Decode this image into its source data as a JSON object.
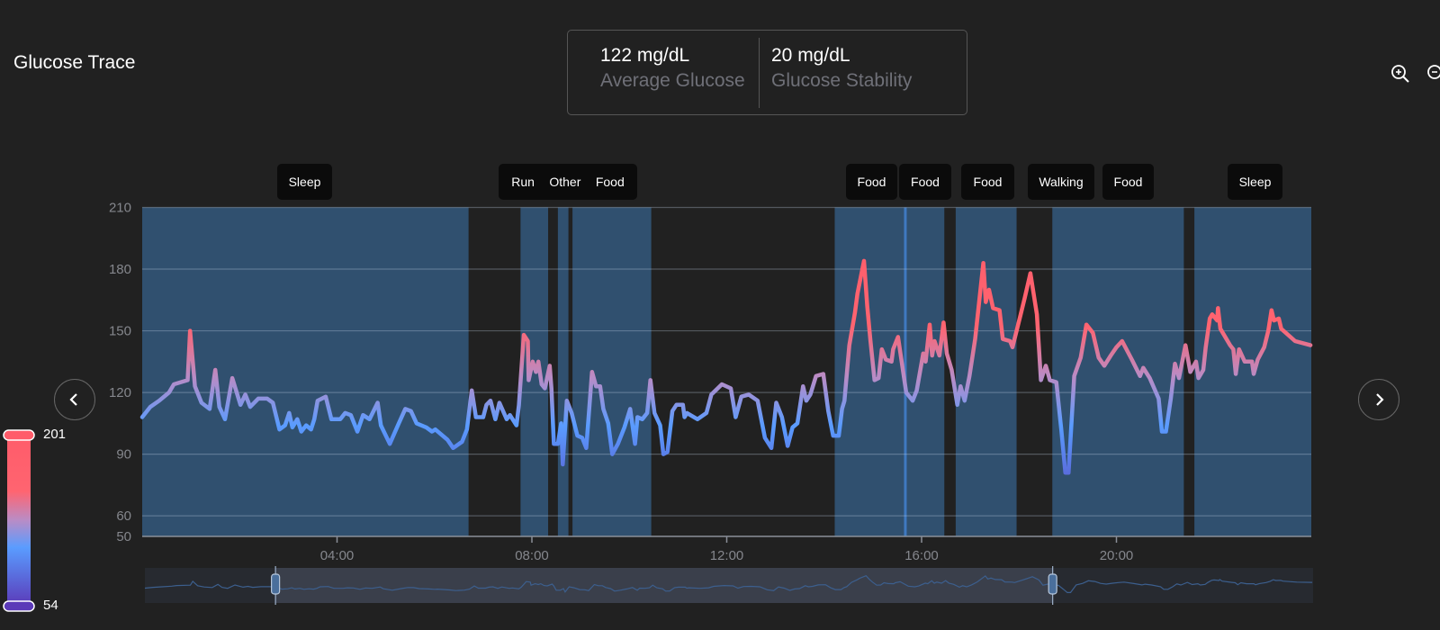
{
  "header": {
    "title": "Glucose Trace"
  },
  "stats": [
    {
      "value": "122 mg/dL",
      "label": "Average Glucose"
    },
    {
      "value": "20 mg/dL",
      "label": "Glucose Stability"
    }
  ],
  "toolbar": {
    "zoom_in_icon": "zoom-in-icon",
    "zoom_out_icon": "zoom-out-icon"
  },
  "navigation": {
    "prev_icon": "chevron-left-icon",
    "next_icon": "chevron-right-icon"
  },
  "legend": {
    "max": "201",
    "min": "54",
    "colors": [
      "#ff5c6a",
      "#ff6470",
      "#b98cc6",
      "#5a9cff",
      "#5b3ab8"
    ]
  },
  "events": [
    "Sleep",
    "Run",
    "Other",
    "Food",
    "Food",
    "Food",
    "Food",
    "Walking",
    "Food",
    "Sleep"
  ],
  "navigator": {
    "selection": [
      "02:41",
      "18:39"
    ]
  },
  "colors": {
    "background": "#212121",
    "band": "#30506f",
    "line_high": "#ff5c6a",
    "line_mid": "#b98cc6",
    "line_low": "#5a9cff"
  },
  "chart_data": {
    "type": "line",
    "title": "",
    "xlabel": "",
    "ylabel": "",
    "ylim": [
      50,
      210
    ],
    "xlim": [
      "00:00",
      "24:00"
    ],
    "yticks": [
      50,
      60,
      90,
      120,
      150,
      180,
      210
    ],
    "xticks": [
      "04:00",
      "08:00",
      "12:00",
      "16:00",
      "20:00"
    ],
    "grid": true,
    "color_scale": {
      "min": 54,
      "max": 201
    },
    "bands": [
      [
        "00:00",
        "06:42"
      ],
      [
        "07:46",
        "08:20"
      ],
      [
        "08:32",
        "08:45"
      ],
      [
        "08:50",
        "10:27"
      ],
      [
        "14:13",
        "16:28"
      ],
      [
        "16:42",
        "17:57"
      ],
      [
        "18:41",
        "21:23"
      ],
      [
        "21:36",
        "24:00"
      ]
    ],
    "marker_lines": [
      "15:40"
    ],
    "points": [
      [
        "00:00",
        108
      ],
      [
        "00:10",
        113
      ],
      [
        "00:21",
        116
      ],
      [
        "00:33",
        120
      ],
      [
        "00:39",
        124
      ],
      [
        "00:56",
        126
      ],
      [
        "00:59",
        150
      ],
      [
        "01:05",
        123
      ],
      [
        "01:13",
        115
      ],
      [
        "01:23",
        112
      ],
      [
        "01:30",
        131
      ],
      [
        "01:35",
        113
      ],
      [
        "01:42",
        107
      ],
      [
        "01:51",
        127
      ],
      [
        "02:01",
        114
      ],
      [
        "02:07",
        119
      ],
      [
        "02:13",
        113
      ],
      [
        "02:23",
        117
      ],
      [
        "02:34",
        117
      ],
      [
        "02:41",
        115
      ],
      [
        "02:49",
        102
      ],
      [
        "02:56",
        104
      ],
      [
        "03:01",
        110
      ],
      [
        "03:05",
        103
      ],
      [
        "03:11",
        107
      ],
      [
        "03:16",
        101
      ],
      [
        "03:22",
        104
      ],
      [
        "03:28",
        102
      ],
      [
        "03:32",
        107
      ],
      [
        "03:36",
        116
      ],
      [
        "03:46",
        118
      ],
      [
        "03:53",
        107
      ],
      [
        "04:04",
        107
      ],
      [
        "04:10",
        110
      ],
      [
        "04:17",
        109
      ],
      [
        "04:25",
        101
      ],
      [
        "04:32",
        109
      ],
      [
        "04:40",
        107
      ],
      [
        "04:50",
        115
      ],
      [
        "04:54",
        104
      ],
      [
        "05:05",
        95
      ],
      [
        "05:16",
        105
      ],
      [
        "05:24",
        112
      ],
      [
        "05:31",
        111
      ],
      [
        "05:38",
        105
      ],
      [
        "05:50",
        103
      ],
      [
        "05:57",
        101
      ],
      [
        "06:01",
        102
      ],
      [
        "06:16",
        97
      ],
      [
        "06:23",
        93
      ],
      [
        "06:34",
        96
      ],
      [
        "06:40",
        102
      ],
      [
        "06:46",
        121
      ],
      [
        "06:51",
        108
      ],
      [
        "07:00",
        108
      ],
      [
        "07:04",
        114
      ],
      [
        "07:09",
        116
      ],
      [
        "07:15",
        107
      ],
      [
        "07:20",
        115
      ],
      [
        "07:29",
        107
      ],
      [
        "07:33",
        109
      ],
      [
        "07:41",
        104
      ],
      [
        "07:44",
        114
      ],
      [
        "07:50",
        148
      ],
      [
        "07:55",
        145
      ],
      [
        "07:56",
        126
      ],
      [
        "08:01",
        135
      ],
      [
        "08:05",
        130
      ],
      [
        "08:08",
        135
      ],
      [
        "08:12",
        124
      ],
      [
        "08:16",
        122
      ],
      [
        "08:22",
        133
      ],
      [
        "08:24",
        122
      ],
      [
        "08:27",
        95
      ],
      [
        "08:32",
        95
      ],
      [
        "08:36",
        105
      ],
      [
        "08:38",
        85
      ],
      [
        "08:43",
        116
      ],
      [
        "08:49",
        110
      ],
      [
        "08:56",
        99
      ],
      [
        "09:02",
        98
      ],
      [
        "09:07",
        93
      ],
      [
        "09:14",
        130
      ],
      [
        "09:19",
        123
      ],
      [
        "09:24",
        123
      ],
      [
        "09:28",
        112
      ],
      [
        "09:34",
        105
      ],
      [
        "09:39",
        90
      ],
      [
        "09:46",
        95
      ],
      [
        "09:54",
        103
      ],
      [
        "10:01",
        112
      ],
      [
        "10:07",
        95
      ],
      [
        "10:10",
        108
      ],
      [
        "10:16",
        107
      ],
      [
        "10:22",
        110
      ],
      [
        "10:26",
        126
      ],
      [
        "10:31",
        110
      ],
      [
        "10:38",
        104
      ],
      [
        "10:42",
        90
      ],
      [
        "10:47",
        91
      ],
      [
        "10:53",
        111
      ],
      [
        "10:58",
        114
      ],
      [
        "11:06",
        114
      ],
      [
        "11:08",
        108
      ],
      [
        "11:11",
        110
      ],
      [
        "11:24",
        107
      ],
      [
        "11:35",
        110
      ],
      [
        "11:41",
        119
      ],
      [
        "11:54",
        124
      ],
      [
        "12:05",
        122
      ],
      [
        "12:11",
        108
      ],
      [
        "12:18",
        118
      ],
      [
        "12:27",
        119
      ],
      [
        "12:38",
        116
      ],
      [
        "12:47",
        98
      ],
      [
        "12:55",
        93
      ],
      [
        "13:01",
        115
      ],
      [
        "13:08",
        108
      ],
      [
        "13:15",
        94
      ],
      [
        "13:21",
        103
      ],
      [
        "13:27",
        105
      ],
      [
        "13:34",
        123
      ],
      [
        "13:38",
        116
      ],
      [
        "13:43",
        119
      ],
      [
        "13:50",
        128
      ],
      [
        "13:59",
        129
      ],
      [
        "14:05",
        111
      ],
      [
        "14:11",
        99
      ],
      [
        "14:18",
        99
      ],
      [
        "14:22",
        112
      ],
      [
        "14:25",
        116
      ],
      [
        "14:31",
        143
      ],
      [
        "14:38",
        159
      ],
      [
        "14:41",
        168
      ],
      [
        "14:49",
        184
      ],
      [
        "14:53",
        162
      ],
      [
        "14:57",
        145
      ],
      [
        "15:02",
        126
      ],
      [
        "15:07",
        127
      ],
      [
        "15:11",
        141
      ],
      [
        "15:16",
        136
      ],
      [
        "15:23",
        135
      ],
      [
        "15:25",
        141
      ],
      [
        "15:31",
        147
      ],
      [
        "15:34",
        139
      ],
      [
        "15:41",
        120
      ],
      [
        "15:49",
        116
      ],
      [
        "15:54",
        121
      ],
      [
        "16:02",
        139
      ],
      [
        "16:05",
        135
      ],
      [
        "16:10",
        153
      ],
      [
        "16:13",
        138
      ],
      [
        "16:16",
        145
      ],
      [
        "16:22",
        138
      ],
      [
        "16:27",
        154
      ],
      [
        "16:31",
        139
      ],
      [
        "16:37",
        131
      ],
      [
        "16:44",
        114
      ],
      [
        "16:48",
        123
      ],
      [
        "16:53",
        116
      ],
      [
        "16:59",
        128
      ],
      [
        "17:06",
        146
      ],
      [
        "17:16",
        183
      ],
      [
        "17:19",
        164
      ],
      [
        "17:23",
        170
      ],
      [
        "17:28",
        161
      ],
      [
        "17:36",
        160
      ],
      [
        "17:40",
        146
      ],
      [
        "17:49",
        145
      ],
      [
        "17:52",
        142
      ],
      [
        "18:02",
        158
      ],
      [
        "18:07",
        166
      ],
      [
        "18:14",
        178
      ],
      [
        "18:22",
        158
      ],
      [
        "18:27",
        126
      ],
      [
        "18:33",
        133
      ],
      [
        "18:38",
        126
      ],
      [
        "18:46",
        125
      ],
      [
        "18:52",
        102
      ],
      [
        "18:57",
        81
      ],
      [
        "19:01",
        81
      ],
      [
        "19:08",
        128
      ],
      [
        "19:16",
        137
      ],
      [
        "19:23",
        153
      ],
      [
        "19:31",
        149
      ],
      [
        "19:38",
        137
      ],
      [
        "19:45",
        133
      ],
      [
        "19:53",
        138
      ],
      [
        "20:00",
        142
      ],
      [
        "20:07",
        145
      ],
      [
        "20:19",
        136
      ],
      [
        "20:29",
        128
      ],
      [
        "20:33",
        132
      ],
      [
        "20:41",
        127
      ],
      [
        "20:52",
        117
      ],
      [
        "20:56",
        101
      ],
      [
        "21:01",
        101
      ],
      [
        "21:07",
        117
      ],
      [
        "21:12",
        134
      ],
      [
        "21:17",
        127
      ],
      [
        "21:25",
        143
      ],
      [
        "21:31",
        130
      ],
      [
        "21:38",
        135
      ],
      [
        "21:41",
        127
      ],
      [
        "21:47",
        131
      ],
      [
        "21:50",
        142
      ],
      [
        "21:55",
        156
      ],
      [
        "21:58",
        158
      ],
      [
        "22:04",
        155
      ],
      [
        "22:05",
        161
      ],
      [
        "22:08",
        151
      ],
      [
        "22:20",
        143
      ],
      [
        "22:24",
        141
      ],
      [
        "22:27",
        129
      ],
      [
        "22:31",
        141
      ],
      [
        "22:38",
        135
      ],
      [
        "22:47",
        135
      ],
      [
        "22:49",
        129
      ],
      [
        "22:54",
        136
      ],
      [
        "23:02",
        142
      ],
      [
        "23:07",
        150
      ],
      [
        "23:11",
        160
      ],
      [
        "23:14",
        155
      ],
      [
        "23:20",
        156
      ],
      [
        "23:23",
        151
      ],
      [
        "23:40",
        145
      ],
      [
        "23:59",
        143
      ]
    ]
  }
}
